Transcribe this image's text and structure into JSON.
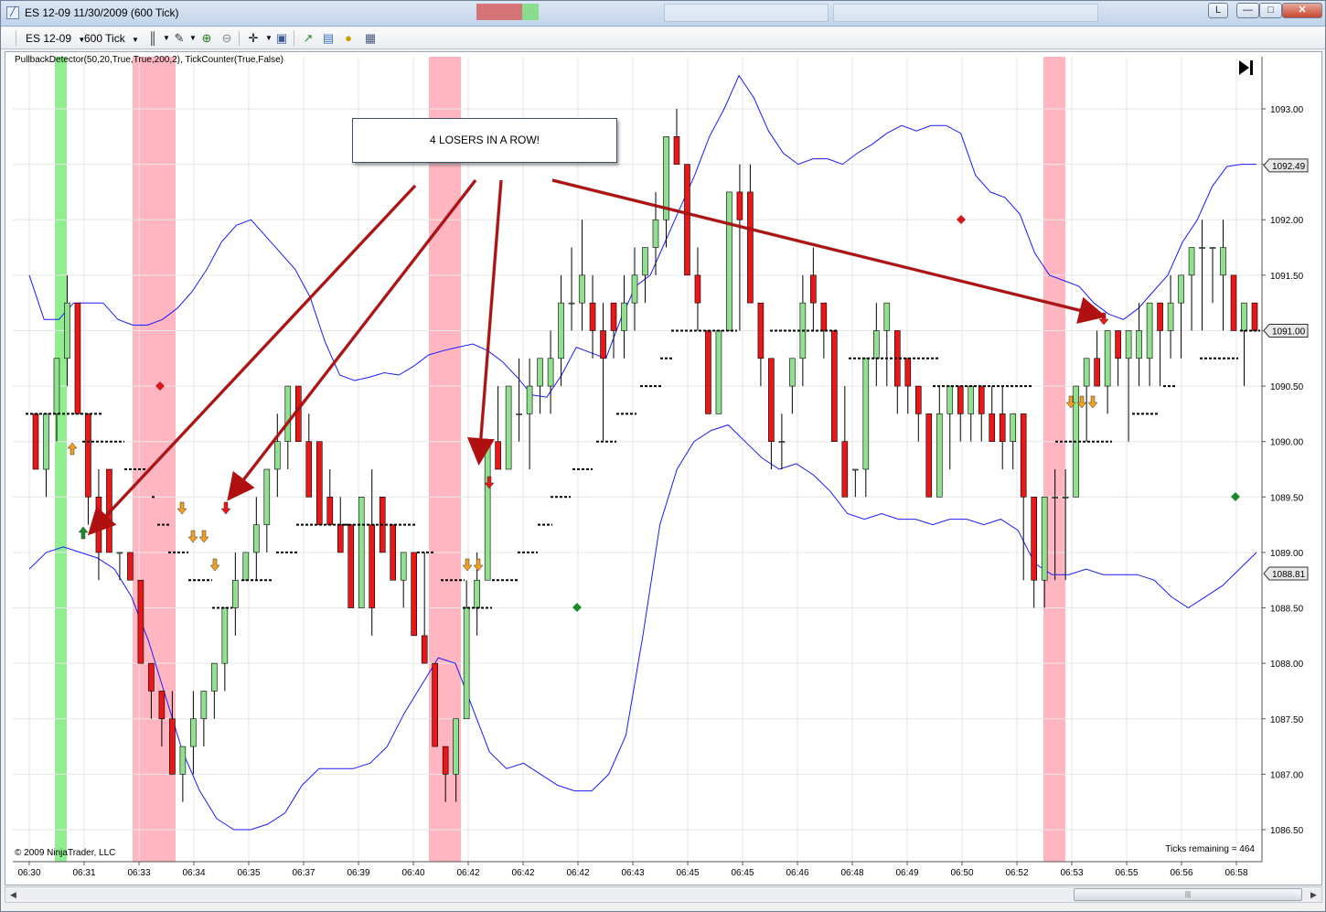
{
  "window": {
    "title": "ES 12-09  11/30/2009 (600 Tick)",
    "link_button": "L",
    "min_button": "—",
    "max_button": "□",
    "close_button": "✕"
  },
  "toolbar": {
    "instrument": "ES 12-09",
    "interval": "600 Tick",
    "icons": [
      "bar-style-icon",
      "draw-pen-icon",
      "zoom-in-icon",
      "zoom-out-icon",
      "crosshair-icon",
      "properties-icon",
      "chart-icon",
      "folder-icon",
      "currency-icon",
      "data-box-icon"
    ]
  },
  "chart": {
    "indicator_label": "PullbackDetector(50,20,True,True,200,2), TickCounter(True,False)",
    "copyright": "© 2009 NinjaTrader, LLC",
    "ticks_remaining": "Ticks remaining = 464",
    "callout": "4 LOSERS IN A ROW!"
  },
  "colors": {
    "up": "#90e090",
    "down": "#e81818",
    "band": "#1a1aff",
    "pink": "#ffb6c1",
    "green_zone": "#90ee90",
    "arrow": "#b01010",
    "down_signal_orange": "#f0a020",
    "diamond_red": "#d81818",
    "diamond_green": "#1a8a2a"
  },
  "chart_data": {
    "type": "candlestick",
    "instrument": "ES 12-09",
    "interval": "600 Tick",
    "y_ticks": [
      "1093.00",
      "1092.50",
      "1092.00",
      "1091.50",
      "1091.00",
      "1090.50",
      "1090.00",
      "1089.50",
      "1089.00",
      "1088.50",
      "1088.00",
      "1087.50",
      "1087.00",
      "1086.50"
    ],
    "price_markers": [
      "1092.49",
      "1091.00",
      "1088.81"
    ],
    "x_ticks": [
      "06:30",
      "06:31",
      "06:33",
      "06:34",
      "06:35",
      "06:37",
      "06:39",
      "06:40",
      "06:42",
      "06:42",
      "06:42",
      "06:43",
      "06:45",
      "06:45",
      "06:46",
      "06:48",
      "06:49",
      "06:50",
      "06:52",
      "06:53",
      "06:55",
      "06:56",
      "06:58"
    ],
    "ylim": [
      1086.4,
      1093.3
    ],
    "candles": [
      {
        "o": 1090.25,
        "h": 1090.25,
        "l": 1089.75,
        "c": 1089.75
      },
      {
        "o": 1089.75,
        "h": 1090.25,
        "l": 1089.5,
        "c": 1090.25
      },
      {
        "o": 1090.25,
        "h": 1090.75,
        "l": 1090.0,
        "c": 1090.75
      },
      {
        "o": 1090.75,
        "h": 1091.5,
        "l": 1090.5,
        "c": 1091.25
      },
      {
        "o": 1091.25,
        "h": 1091.25,
        "l": 1090.25,
        "c": 1090.25
      },
      {
        "o": 1090.25,
        "h": 1090.25,
        "l": 1089.25,
        "c": 1089.5
      },
      {
        "o": 1089.5,
        "h": 1089.75,
        "l": 1088.75,
        "c": 1089.0
      },
      {
        "o": 1089.75,
        "h": 1089.75,
        "l": 1089.0,
        "c": 1089.0
      },
      {
        "o": 1089.0,
        "h": 1089.0,
        "l": 1088.75,
        "c": 1089.0
      },
      {
        "o": 1089.0,
        "h": 1089.0,
        "l": 1088.75,
        "c": 1088.75
      },
      {
        "o": 1088.75,
        "h": 1088.75,
        "l": 1088.0,
        "c": 1088.0
      },
      {
        "o": 1088.0,
        "h": 1088.0,
        "l": 1087.5,
        "c": 1087.75
      },
      {
        "o": 1087.75,
        "h": 1087.75,
        "l": 1087.25,
        "c": 1087.5
      },
      {
        "o": 1087.5,
        "h": 1087.75,
        "l": 1087.0,
        "c": 1087.0
      },
      {
        "o": 1087.0,
        "h": 1087.25,
        "l": 1086.75,
        "c": 1087.25
      },
      {
        "o": 1087.25,
        "h": 1087.75,
        "l": 1087.0,
        "c": 1087.5
      },
      {
        "o": 1087.5,
        "h": 1087.75,
        "l": 1087.25,
        "c": 1087.75
      },
      {
        "o": 1087.75,
        "h": 1088.0,
        "l": 1087.5,
        "c": 1088.0
      },
      {
        "o": 1088.0,
        "h": 1088.5,
        "l": 1087.75,
        "c": 1088.5
      },
      {
        "o": 1088.5,
        "h": 1089.0,
        "l": 1088.25,
        "c": 1088.75
      },
      {
        "o": 1088.75,
        "h": 1089.0,
        "l": 1088.75,
        "c": 1089.0
      },
      {
        "o": 1089.0,
        "h": 1089.5,
        "l": 1088.75,
        "c": 1089.25
      },
      {
        "o": 1089.25,
        "h": 1089.75,
        "l": 1089.0,
        "c": 1089.75
      },
      {
        "o": 1089.75,
        "h": 1090.25,
        "l": 1089.5,
        "c": 1090.0
      },
      {
        "o": 1090.0,
        "h": 1090.5,
        "l": 1089.75,
        "c": 1090.5
      },
      {
        "o": 1090.5,
        "h": 1090.5,
        "l": 1090.0,
        "c": 1090.0
      },
      {
        "o": 1090.0,
        "h": 1090.25,
        "l": 1089.5,
        "c": 1089.5
      },
      {
        "o": 1090.0,
        "h": 1090.0,
        "l": 1089.25,
        "c": 1089.25
      },
      {
        "o": 1089.5,
        "h": 1089.75,
        "l": 1089.25,
        "c": 1089.25
      },
      {
        "o": 1089.25,
        "h": 1089.5,
        "l": 1089.0,
        "c": 1089.0
      },
      {
        "o": 1089.25,
        "h": 1089.25,
        "l": 1088.5,
        "c": 1088.5
      },
      {
        "o": 1088.5,
        "h": 1089.5,
        "l": 1088.5,
        "c": 1089.5
      },
      {
        "o": 1089.25,
        "h": 1089.75,
        "l": 1088.25,
        "c": 1088.5
      },
      {
        "o": 1089.5,
        "h": 1089.5,
        "l": 1089.0,
        "c": 1089.0
      },
      {
        "o": 1089.25,
        "h": 1089.25,
        "l": 1088.75,
        "c": 1088.75
      },
      {
        "o": 1088.75,
        "h": 1089.0,
        "l": 1088.5,
        "c": 1089.0
      },
      {
        "o": 1089.0,
        "h": 1089.0,
        "l": 1088.25,
        "c": 1088.25
      },
      {
        "o": 1088.25,
        "h": 1089.0,
        "l": 1088.0,
        "c": 1088.0
      },
      {
        "o": 1088.0,
        "h": 1088.0,
        "l": 1087.25,
        "c": 1087.25
      },
      {
        "o": 1087.25,
        "h": 1087.25,
        "l": 1086.75,
        "c": 1087.0
      },
      {
        "o": 1087.0,
        "h": 1087.5,
        "l": 1086.75,
        "c": 1087.5
      },
      {
        "o": 1087.5,
        "h": 1088.75,
        "l": 1087.5,
        "c": 1088.5
      },
      {
        "o": 1088.5,
        "h": 1089.0,
        "l": 1088.25,
        "c": 1088.75
      },
      {
        "o": 1088.75,
        "h": 1090.0,
        "l": 1088.75,
        "c": 1090.0
      },
      {
        "o": 1090.0,
        "h": 1090.5,
        "l": 1089.75,
        "c": 1089.75
      },
      {
        "o": 1089.75,
        "h": 1090.5,
        "l": 1089.75,
        "c": 1090.5
      },
      {
        "o": 1090.25,
        "h": 1090.75,
        "l": 1090.0,
        "c": 1090.25
      },
      {
        "o": 1090.25,
        "h": 1090.75,
        "l": 1089.75,
        "c": 1090.5
      },
      {
        "o": 1090.5,
        "h": 1090.75,
        "l": 1090.25,
        "c": 1090.75
      },
      {
        "o": 1090.5,
        "h": 1091.0,
        "l": 1090.25,
        "c": 1090.75
      },
      {
        "o": 1090.75,
        "h": 1091.5,
        "l": 1090.5,
        "c": 1091.25
      },
      {
        "o": 1091.25,
        "h": 1091.75,
        "l": 1091.0,
        "c": 1091.25
      },
      {
        "o": 1091.25,
        "h": 1092.0,
        "l": 1091.0,
        "c": 1091.5
      },
      {
        "o": 1091.25,
        "h": 1091.5,
        "l": 1090.75,
        "c": 1091.0
      },
      {
        "o": 1091.0,
        "h": 1091.25,
        "l": 1090.0,
        "c": 1090.75
      },
      {
        "o": 1091.25,
        "h": 1091.25,
        "l": 1090.75,
        "c": 1091.0
      },
      {
        "o": 1091.0,
        "h": 1091.5,
        "l": 1090.75,
        "c": 1091.25
      },
      {
        "o": 1091.25,
        "h": 1091.75,
        "l": 1091.0,
        "c": 1091.5
      },
      {
        "o": 1091.5,
        "h": 1091.75,
        "l": 1091.25,
        "c": 1091.75
      },
      {
        "o": 1091.75,
        "h": 1092.25,
        "l": 1091.5,
        "c": 1092.0
      },
      {
        "o": 1092.0,
        "h": 1092.75,
        "l": 1091.75,
        "c": 1092.75
      },
      {
        "o": 1092.75,
        "h": 1093.0,
        "l": 1092.5,
        "c": 1092.5
      },
      {
        "o": 1092.5,
        "h": 1092.5,
        "l": 1091.5,
        "c": 1091.5
      },
      {
        "o": 1091.5,
        "h": 1091.75,
        "l": 1091.0,
        "c": 1091.25
      },
      {
        "o": 1091.0,
        "h": 1091.0,
        "l": 1090.25,
        "c": 1090.25
      },
      {
        "o": 1090.25,
        "h": 1091.0,
        "l": 1090.25,
        "c": 1091.0
      },
      {
        "o": 1091.0,
        "h": 1092.25,
        "l": 1091.0,
        "c": 1092.25
      },
      {
        "o": 1092.25,
        "h": 1092.5,
        "l": 1091.0,
        "c": 1092.0
      },
      {
        "o": 1092.25,
        "h": 1092.5,
        "l": 1091.25,
        "c": 1091.25
      },
      {
        "o": 1091.25,
        "h": 1091.25,
        "l": 1090.5,
        "c": 1090.75
      },
      {
        "o": 1090.75,
        "h": 1090.75,
        "l": 1089.75,
        "c": 1090.0
      },
      {
        "o": 1090.0,
        "h": 1090.25,
        "l": 1089.75,
        "c": 1090.0
      },
      {
        "o": 1090.5,
        "h": 1090.75,
        "l": 1090.25,
        "c": 1090.75
      },
      {
        "o": 1090.75,
        "h": 1091.5,
        "l": 1090.5,
        "c": 1091.25
      },
      {
        "o": 1091.5,
        "h": 1091.75,
        "l": 1091.0,
        "c": 1091.25
      },
      {
        "o": 1091.25,
        "h": 1091.25,
        "l": 1090.75,
        "c": 1091.0
      },
      {
        "o": 1091.0,
        "h": 1091.0,
        "l": 1090.0,
        "c": 1090.0
      },
      {
        "o": 1090.0,
        "h": 1090.5,
        "l": 1089.75,
        "c": 1089.5
      },
      {
        "o": 1089.75,
        "h": 1089.75,
        "l": 1089.5,
        "c": 1089.75
      },
      {
        "o": 1089.75,
        "h": 1090.75,
        "l": 1089.5,
        "c": 1090.75
      },
      {
        "o": 1090.75,
        "h": 1091.25,
        "l": 1090.5,
        "c": 1091.0
      },
      {
        "o": 1091.0,
        "h": 1091.25,
        "l": 1090.5,
        "c": 1091.25
      },
      {
        "o": 1091.0,
        "h": 1091.0,
        "l": 1090.25,
        "c": 1090.5
      },
      {
        "o": 1090.75,
        "h": 1090.75,
        "l": 1090.25,
        "c": 1090.5
      },
      {
        "o": 1090.5,
        "h": 1090.5,
        "l": 1090.0,
        "c": 1090.25
      },
      {
        "o": 1090.25,
        "h": 1090.25,
        "l": 1089.5,
        "c": 1089.5
      },
      {
        "o": 1089.5,
        "h": 1090.5,
        "l": 1089.5,
        "c": 1090.25
      },
      {
        "o": 1090.25,
        "h": 1090.5,
        "l": 1089.75,
        "c": 1090.5
      },
      {
        "o": 1090.5,
        "h": 1090.5,
        "l": 1090.0,
        "c": 1090.25
      },
      {
        "o": 1090.25,
        "h": 1090.5,
        "l": 1090.0,
        "c": 1090.5
      },
      {
        "o": 1090.5,
        "h": 1090.5,
        "l": 1090.0,
        "c": 1090.25
      },
      {
        "o": 1090.25,
        "h": 1090.5,
        "l": 1090.0,
        "c": 1090.0
      },
      {
        "o": 1090.25,
        "h": 1090.5,
        "l": 1089.75,
        "c": 1090.0
      },
      {
        "o": 1090.0,
        "h": 1090.25,
        "l": 1089.75,
        "c": 1090.25
      },
      {
        "o": 1090.25,
        "h": 1090.25,
        "l": 1088.75,
        "c": 1089.5
      },
      {
        "o": 1089.5,
        "h": 1089.5,
        "l": 1088.5,
        "c": 1088.75
      },
      {
        "o": 1088.75,
        "h": 1089.5,
        "l": 1088.5,
        "c": 1089.5
      },
      {
        "o": 1089.5,
        "h": 1089.75,
        "l": 1088.75,
        "c": 1089.5
      },
      {
        "o": 1089.5,
        "h": 1089.75,
        "l": 1088.75,
        "c": 1089.5
      },
      {
        "o": 1089.5,
        "h": 1090.5,
        "l": 1089.5,
        "c": 1090.5
      },
      {
        "o": 1090.5,
        "h": 1090.75,
        "l": 1090.0,
        "c": 1090.75
      },
      {
        "o": 1090.75,
        "h": 1091.0,
        "l": 1090.5,
        "c": 1090.5
      },
      {
        "o": 1090.5,
        "h": 1091.0,
        "l": 1090.25,
        "c": 1091.0
      },
      {
        "o": 1091.0,
        "h": 1091.0,
        "l": 1090.5,
        "c": 1090.75
      },
      {
        "o": 1090.75,
        "h": 1091.0,
        "l": 1090.0,
        "c": 1091.0
      },
      {
        "o": 1090.75,
        "h": 1091.25,
        "l": 1090.5,
        "c": 1091.0
      },
      {
        "o": 1090.75,
        "h": 1091.25,
        "l": 1090.5,
        "c": 1091.25
      },
      {
        "o": 1091.25,
        "h": 1091.25,
        "l": 1090.5,
        "c": 1091.0
      },
      {
        "o": 1091.0,
        "h": 1091.5,
        "l": 1090.75,
        "c": 1091.25
      },
      {
        "o": 1091.25,
        "h": 1091.5,
        "l": 1090.75,
        "c": 1091.5
      },
      {
        "o": 1091.5,
        "h": 1091.75,
        "l": 1091.0,
        "c": 1091.75
      },
      {
        "o": 1091.75,
        "h": 1092.0,
        "l": 1091.0,
        "c": 1091.75
      },
      {
        "o": 1091.75,
        "h": 1091.75,
        "l": 1091.25,
        "c": 1091.75
      },
      {
        "o": 1091.5,
        "h": 1092.0,
        "l": 1091.0,
        "c": 1091.75
      },
      {
        "o": 1091.5,
        "h": 1091.5,
        "l": 1091.0,
        "c": 1091.0
      },
      {
        "o": 1091.0,
        "h": 1091.25,
        "l": 1090.5,
        "c": 1091.25
      },
      {
        "o": 1091.25,
        "h": 1091.25,
        "l": 1091.0,
        "c": 1091.0
      }
    ],
    "upper_band": [
      1091.5,
      1091.1,
      1091.1,
      1091.25,
      1091.25,
      1091.25,
      1091.1,
      1091.05,
      1091.05,
      1091.1,
      1091.2,
      1091.35,
      1091.55,
      1091.8,
      1091.95,
      1092.0,
      1091.85,
      1091.7,
      1091.55,
      1091.3,
      1090.9,
      1090.6,
      1090.55,
      1090.58,
      1090.62,
      1090.6,
      1090.68,
      1090.78,
      1090.82,
      1090.85,
      1090.88,
      1090.82,
      1090.72,
      1090.58,
      1090.42,
      1090.4,
      1090.6,
      1090.85,
      1090.8,
      1090.75,
      1091.1,
      1091.4,
      1091.5,
      1091.8,
      1092.1,
      1092.4,
      1092.75,
      1093.0,
      1093.3,
      1093.1,
      1092.8,
      1092.6,
      1092.5,
      1092.55,
      1092.55,
      1092.5,
      1092.6,
      1092.68,
      1092.78,
      1092.85,
      1092.8,
      1092.85,
      1092.85,
      1092.78,
      1092.4,
      1092.25,
      1092.2,
      1092.05,
      1091.7,
      1091.5,
      1091.45,
      1091.4,
      1091.25,
      1091.15,
      1091.1,
      1091.2,
      1091.35,
      1091.5,
      1091.8,
      1092.0,
      1092.3,
      1092.48,
      1092.5,
      1092.5
    ],
    "lower_band": [
      1088.85,
      1089.0,
      1089.05,
      1089.0,
      1088.95,
      1088.85,
      1088.6,
      1088.2,
      1087.7,
      1087.2,
      1086.85,
      1086.6,
      1086.5,
      1086.5,
      1086.55,
      1086.65,
      1086.9,
      1087.05,
      1087.05,
      1087.05,
      1087.1,
      1087.25,
      1087.55,
      1087.8,
      1088.05,
      1088.0,
      1087.6,
      1087.2,
      1087.05,
      1087.1,
      1087.0,
      1086.9,
      1086.85,
      1086.85,
      1087.0,
      1087.35,
      1088.25,
      1089.25,
      1089.75,
      1090.0,
      1090.1,
      1090.15,
      1090.0,
      1089.85,
      1089.75,
      1089.8,
      1089.7,
      1089.55,
      1089.35,
      1089.3,
      1089.35,
      1089.3,
      1089.3,
      1089.25,
      1089.3,
      1089.3,
      1089.25,
      1089.3,
      1089.2,
      1088.9,
      1088.8,
      1088.8,
      1088.85,
      1088.8,
      1088.8,
      1088.8,
      1088.75,
      1088.6,
      1088.5,
      1088.6,
      1088.7,
      1088.85,
      1089.0
    ],
    "annotations": [
      {
        "type": "text-callout",
        "text": "4 LOSERS IN A ROW!"
      }
    ]
  }
}
